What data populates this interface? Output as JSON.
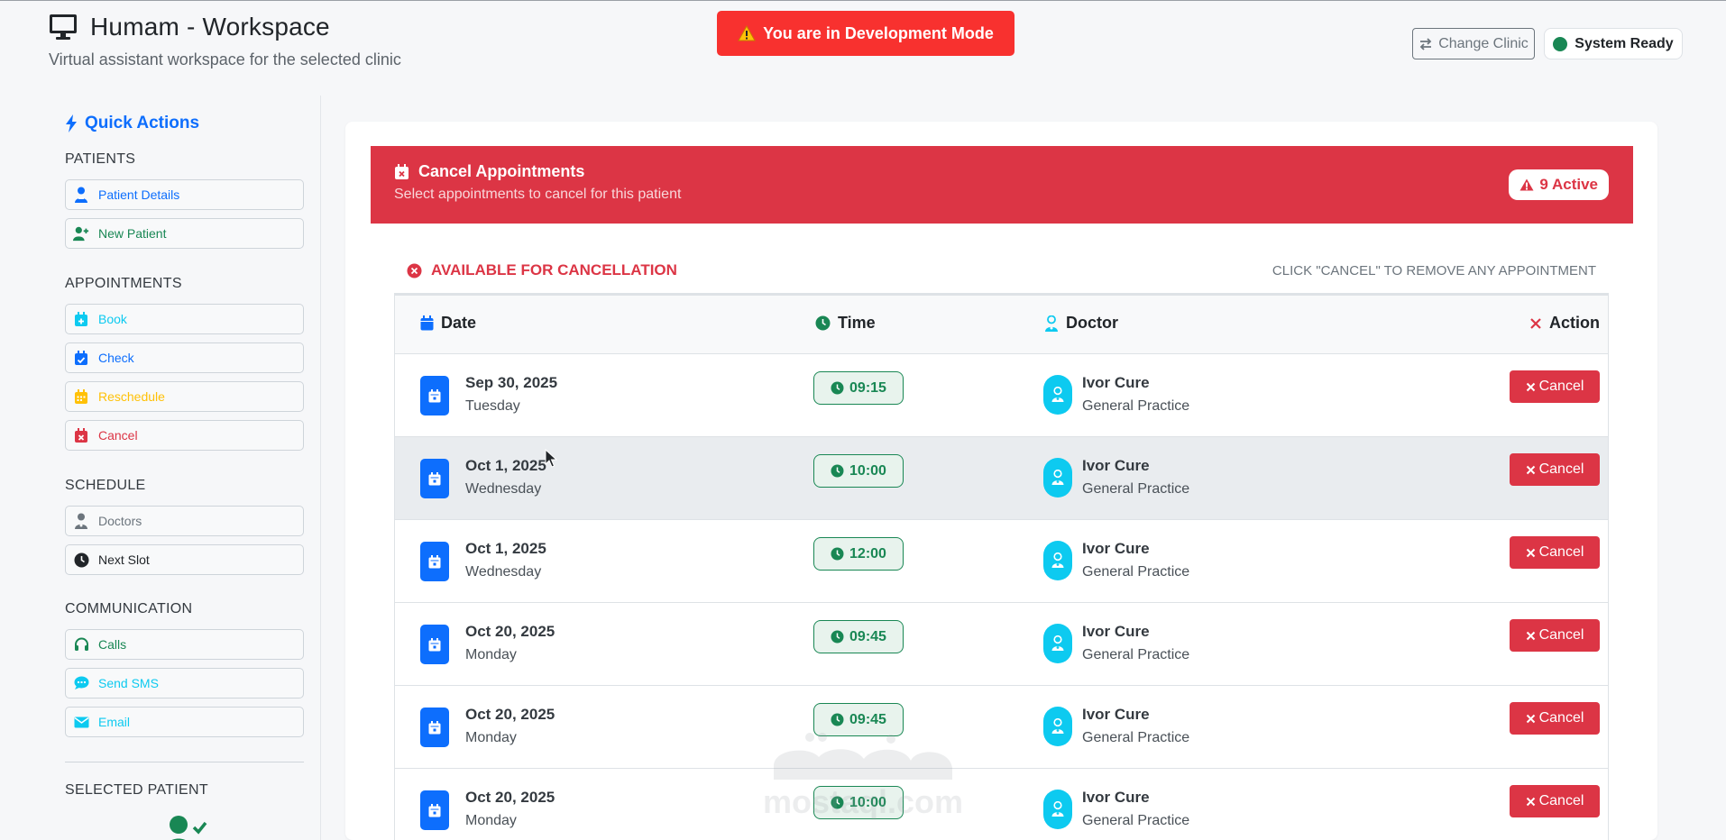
{
  "header": {
    "title": "Humam - Workspace",
    "subtitle": "Virtual assistant workspace for the selected clinic",
    "dev_banner": "You are in Development Mode",
    "change_clinic": "Change Clinic",
    "system_status": "System Ready"
  },
  "sidebar": {
    "quick_actions": "Quick Actions",
    "sections": {
      "patients": "PATIENTS",
      "appointments": "APPOINTMENTS",
      "schedule": "SCHEDULE",
      "communication": "COMMUNICATION",
      "selected_patient": "SELECTED PATIENT"
    },
    "buttons": {
      "patient_details": "Patient Details",
      "new_patient": "New Patient",
      "book": "Book",
      "check": "Check",
      "reschedule": "Reschedule",
      "cancel": "Cancel",
      "doctors": "Doctors",
      "next_slot": "Next Slot",
      "calls": "Calls",
      "send_sms": "Send SMS",
      "email": "Email"
    }
  },
  "cancel_panel": {
    "title": "Cancel Appointments",
    "subtitle": "Select appointments to cancel for this patient",
    "active_badge": "9 Active",
    "available_title": "AVAILABLE FOR CANCELLATION",
    "hint": "CLICK \"CANCEL\" TO REMOVE ANY APPOINTMENT",
    "columns": {
      "date": "Date",
      "time": "Time",
      "doctor": "Doctor",
      "action": "Action"
    },
    "cancel_label": "Cancel",
    "rows": [
      {
        "date": "Sep 30, 2025",
        "day": "Tuesday",
        "time": "09:15",
        "doctor": "Ivor Cure",
        "specialty": "General Practice"
      },
      {
        "date": "Oct 1, 2025",
        "day": "Wednesday",
        "time": "10:00",
        "doctor": "Ivor Cure",
        "specialty": "General Practice"
      },
      {
        "date": "Oct 1, 2025",
        "day": "Wednesday",
        "time": "12:00",
        "doctor": "Ivor Cure",
        "specialty": "General Practice"
      },
      {
        "date": "Oct 20, 2025",
        "day": "Monday",
        "time": "09:45",
        "doctor": "Ivor Cure",
        "specialty": "General Practice"
      },
      {
        "date": "Oct 20, 2025",
        "day": "Monday",
        "time": "09:45",
        "doctor": "Ivor Cure",
        "specialty": "General Practice"
      },
      {
        "date": "Oct 20, 2025",
        "day": "Monday",
        "time": "10:00",
        "doctor": "Ivor Cure",
        "specialty": "General Practice"
      }
    ]
  },
  "watermark": "mostaql.com",
  "colors": {
    "primary": "#0d6efd",
    "danger": "#dc3545",
    "success": "#198754",
    "info": "#0dcaf0",
    "warning": "#ffc107",
    "dev_banner": "#f8312f"
  }
}
